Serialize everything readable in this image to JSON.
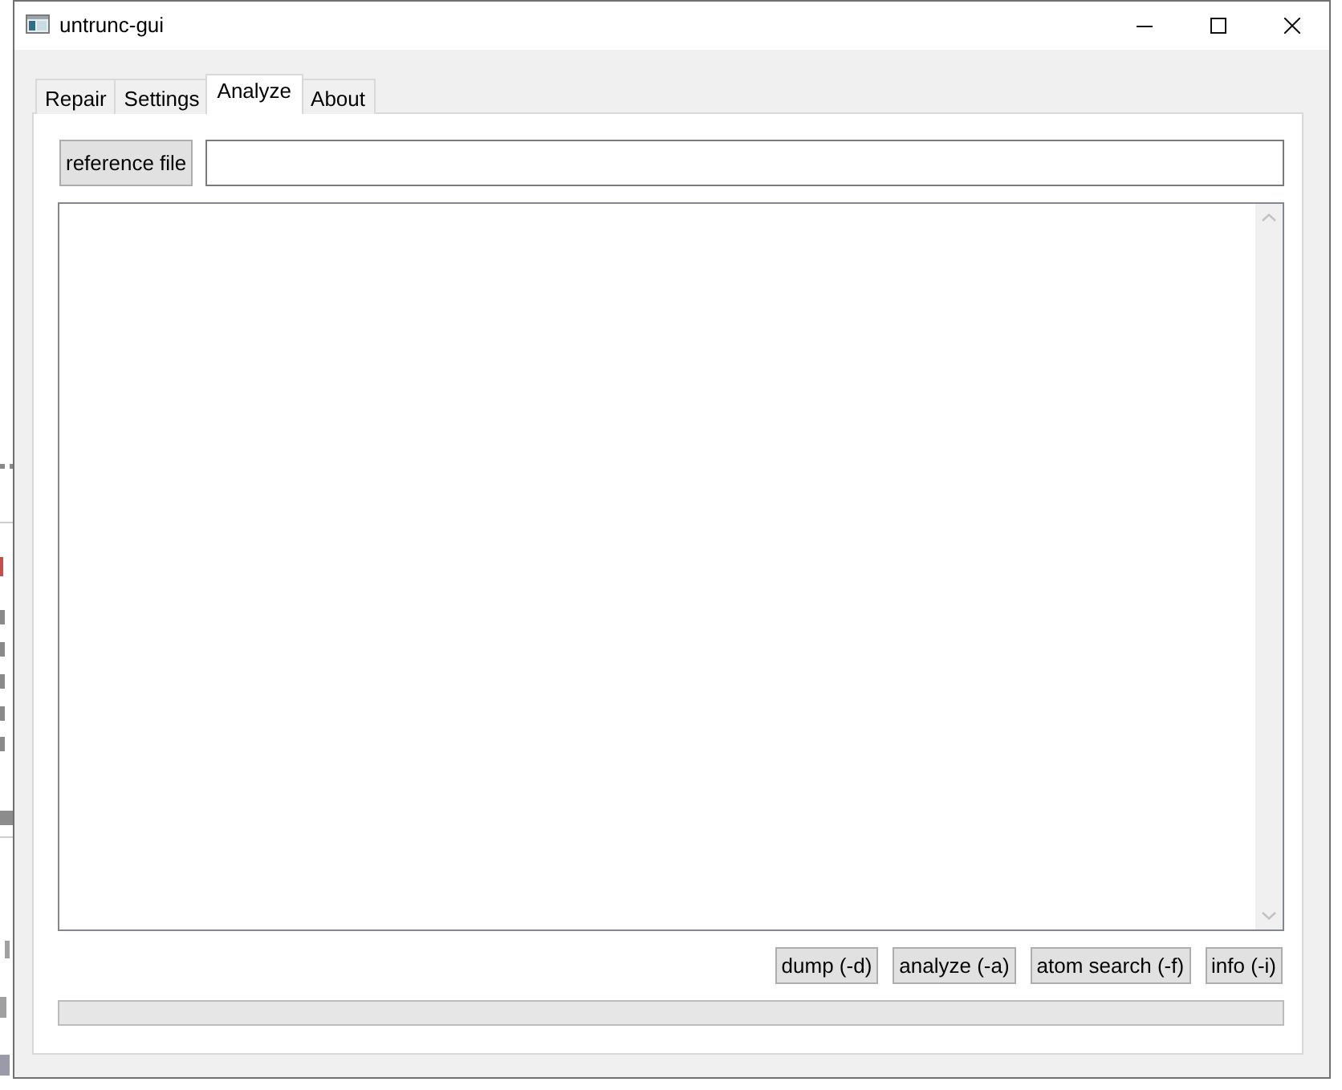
{
  "window": {
    "title": "untrunc-gui"
  },
  "tabs": [
    {
      "label": "Repair",
      "selected": false
    },
    {
      "label": "Settings",
      "selected": false
    },
    {
      "label": "Analyze",
      "selected": true
    },
    {
      "label": "About",
      "selected": false
    }
  ],
  "reference_file_button": "reference file",
  "actions": [
    "dump (-d)",
    "analyze (-a)",
    "atom search (-f)",
    "info (-i)"
  ],
  "progress": {
    "level": 0
  }
}
